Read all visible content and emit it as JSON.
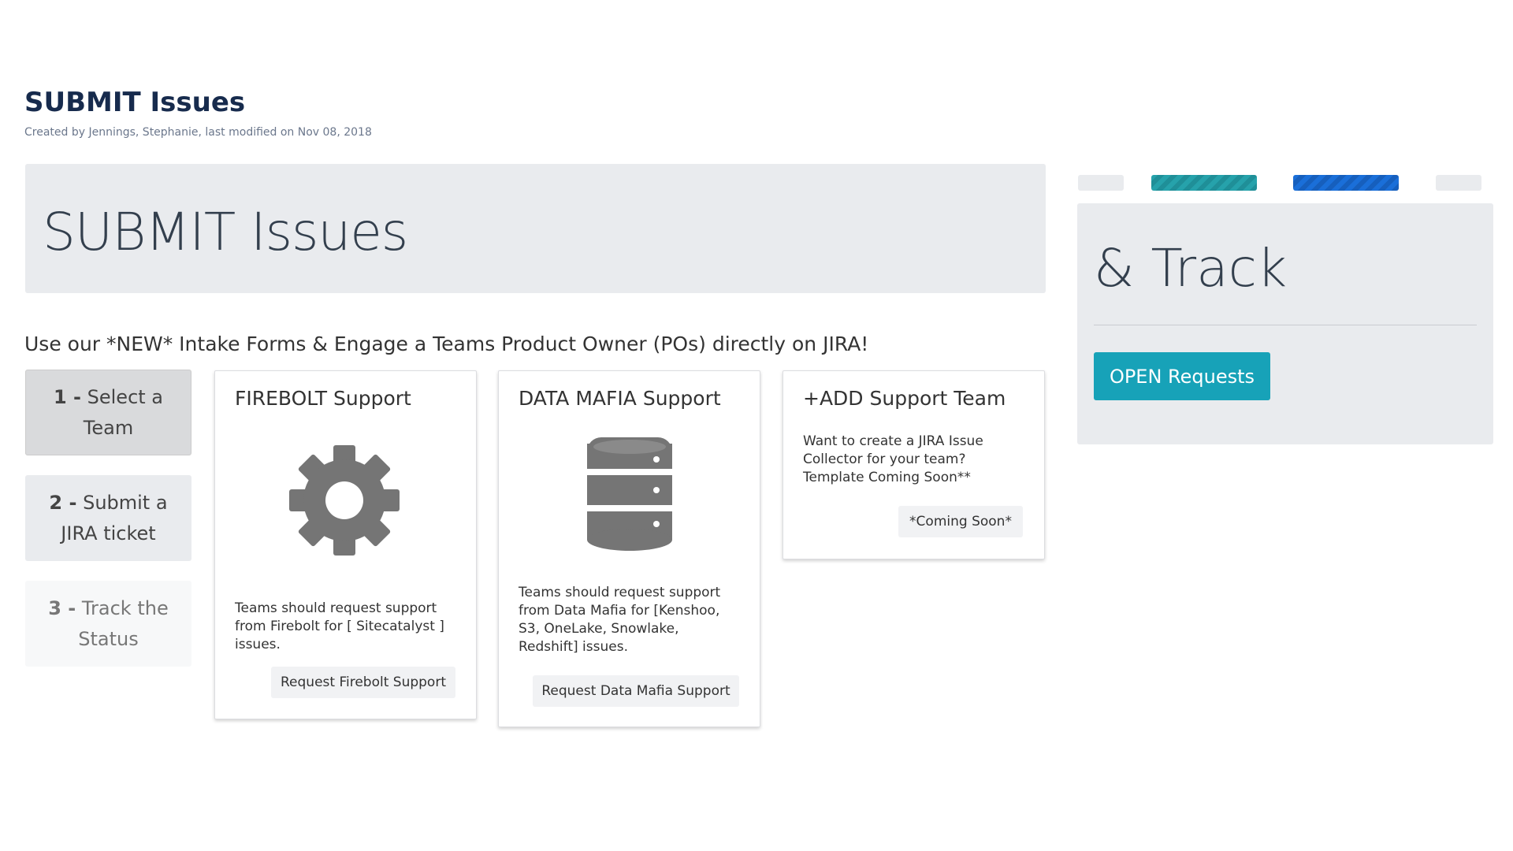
{
  "page": {
    "title": "SUBMIT Issues",
    "meta": "Created by Jennings, Stephanie, last modified on Nov 08, 2018"
  },
  "hero": {
    "text": "SUBMIT Issues"
  },
  "intro": "Use our *NEW* Intake Forms & Engage a Teams Product Owner (POs) directly on JIRA!",
  "steps": [
    {
      "num": "1 -",
      "label": "Select a Team"
    },
    {
      "num": "2 -",
      "label": "Submit a JIRA ticket"
    },
    {
      "num": "3 -",
      "label": "Track the Status"
    }
  ],
  "cards": [
    {
      "title": "FIREBOLT Support",
      "icon": "gear-icon",
      "description": "Teams should request support from Firebolt for [ Sitecatalyst ] issues.",
      "button": "Request Firebolt Support"
    },
    {
      "title": "DATA MAFIA Support",
      "icon": "database-icon",
      "description": "Teams should request support from Data Mafia for [Kenshoo, S3, OneLake, Snowlake, Redshift] issues.",
      "button": "Request Data Mafia Support"
    },
    {
      "title": "+ADD Support Team",
      "description": "Want to create a JIRA Issue Collector for your team? Template Coming Soon**",
      "button": "*Coming Soon*"
    }
  ],
  "track": {
    "title": "& Track",
    "button": "OPEN Requests"
  },
  "colors": {
    "accent": "#17a2b8",
    "tab_teal": "#26a2ab",
    "tab_blue": "#1a6fd9",
    "panel_bg": "#e9ebee"
  }
}
